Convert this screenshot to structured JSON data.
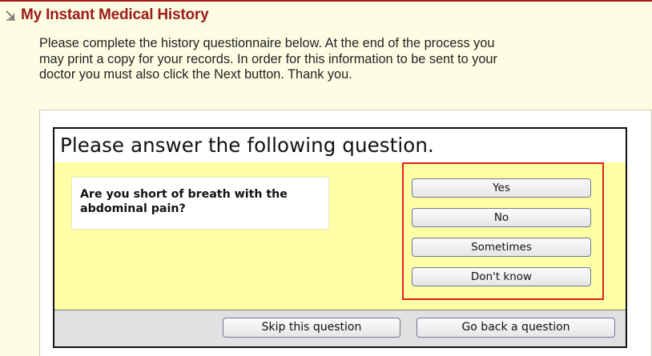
{
  "header": {
    "icon": "collapse-arrow-icon",
    "title": "My Instant Medical History",
    "title_color": "#9c1a1a"
  },
  "intro": {
    "line1": "Please complete the history questionnaire below. At the end of the process you",
    "line2": "may print a copy for your records. In order for this information to be sent to your",
    "line3": "doctor you must also click the Next button. Thank you."
  },
  "question_panel": {
    "heading": "Please answer the following question.",
    "question": "Are you short of breath with the abdominal pain?",
    "answers": [
      {
        "label": "Yes"
      },
      {
        "label": "No"
      },
      {
        "label": "Sometimes"
      },
      {
        "label": "Don't know"
      }
    ],
    "highlight_color": "#e0201f"
  },
  "footer": {
    "skip_label": "Skip this question",
    "back_label": "Go back a question"
  },
  "colors": {
    "page_background": "#fdfde4",
    "question_area": "#ffffa6",
    "footer_bar": "#e1e1e1"
  }
}
